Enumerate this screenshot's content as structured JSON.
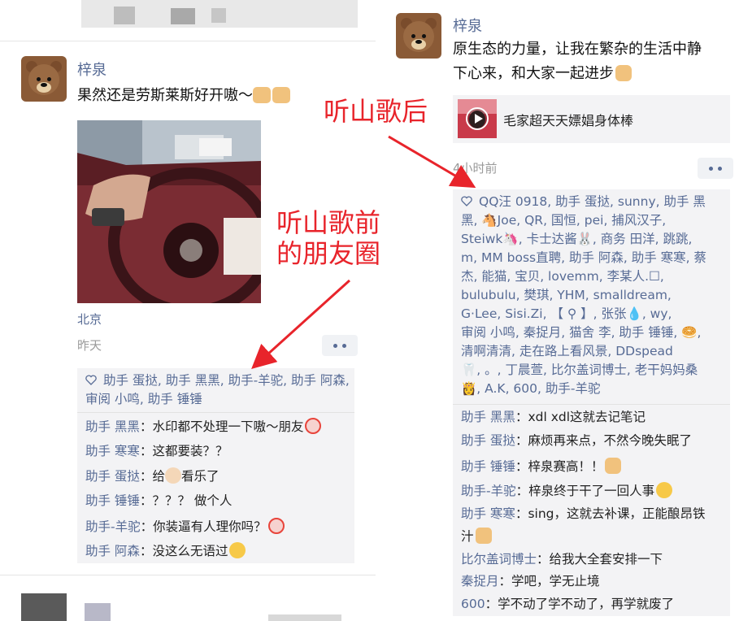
{
  "left_post": {
    "name": "梓泉",
    "text": "果然还是劳斯莱斯好开嗷～",
    "location": "北京",
    "time": "昨天",
    "likes": "助手 蛋挞, 助手 黑黑, 助手-羊驼, 助手 阿森, 审阅 小鸣, 助手 锤锤",
    "comments": [
      {
        "who": "助手 黑黑",
        "text": "水印都不处理一下嗷～朋友"
      },
      {
        "who": "助手 寒寒",
        "text": "这都要装？？"
      },
      {
        "who": "助手 蛋挞",
        "text": "给",
        "text2": "看乐了"
      },
      {
        "who": "助手 锤锤",
        "text": "？？？ 做个人"
      },
      {
        "who": "助手-羊驼",
        "text": "你装逼有人理你吗？"
      },
      {
        "who": "助手 阿森",
        "text": "没这么无语过"
      }
    ]
  },
  "right_post": {
    "name": "梓泉",
    "text_line1": "原生态的力量，让我在繁杂的生活中静",
    "text_line2": "下心来，和大家一起进步",
    "link_title": "毛家超天天嫖娼身体棒",
    "time": "4小时前",
    "likes_lines": [
      "QQ汪 0918, 助手 蛋挞, sunny, 助手 黑",
      "黑, 🐴Joe, QR, 国恒, pei, 捕风汉子,",
      "Steiwk🦄, 卡士达酱🐰, 商务 田洋, 跳跳,",
      "m, MM boss直聘, 助手 阿森, 助手 寒寒, 蔡",
      "杰, 能猫, 宝贝, lovemm, 李某人.☐,",
      "bulubulu, 樊琪, YHM, smalldream,",
      "G·Lee, Sisi.Zi, 【  ⚲  】, 张张💧, wy,",
      "审阅 小鸣, 秦捉月, 猫舍 李, 助手 锤锤, 🥯,",
      "清啊清清, 走在路上看风景, DDspead",
      "🦷, 。, 丁晨萱, 比尔盖词博士, 老干妈妈桑",
      "👸, A.K, 600, 助手-羊驼"
    ],
    "comments": [
      {
        "who": "助手 黑黑",
        "text": "xdl xdl这就去记笔记"
      },
      {
        "who": "助手 蛋挞",
        "text": "麻烦再来点，不然今晚失眠了"
      },
      {
        "who": "助手 锤锤",
        "text": "梓泉赛高！！"
      },
      {
        "who": "助手-羊驼",
        "text": "梓泉终于干了一回人事"
      },
      {
        "who": "助手 寒寒",
        "text": "sing，这就去补课，正能酿昂铁",
        "text2": "汁"
      },
      {
        "who": "比尔盖词博士",
        "text": "给我大全套安排一下"
      },
      {
        "who": "秦捉月",
        "text": "学吧，学无止境"
      },
      {
        "who": "600",
        "text": "学不动了学不动了，再学就废了"
      }
    ]
  },
  "annotations": {
    "before_line1": "听山歌前",
    "before_line2": "的朋友圈",
    "after": "听山歌后"
  },
  "colors": {
    "link_blue": "#576b95",
    "annotation_red": "#e8242b",
    "panel_gray": "#f3f3f5"
  },
  "icons": [
    "bear-avatar-icon",
    "heart-icon",
    "more-dots-icon",
    "play-icon"
  ]
}
